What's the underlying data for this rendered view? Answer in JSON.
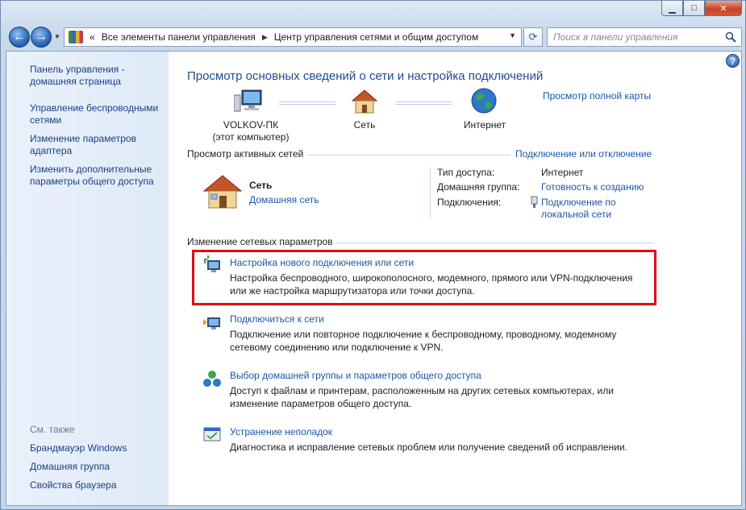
{
  "window": {
    "caption_buttons": {
      "minimize": "▁",
      "maximize": "□",
      "close": "✕"
    }
  },
  "navbar": {
    "back_icon": "back-arrow-icon",
    "forward_icon": "forward-arrow-icon",
    "address": {
      "overflow": "«",
      "segments": [
        "Все элементы панели управления",
        "Центр управления сетями и общим доступом"
      ]
    },
    "search_placeholder": "Поиск в панели управления"
  },
  "sidebar": {
    "items": [
      {
        "label_line1": "Панель управления -",
        "label_line2": "домашняя страница"
      },
      {
        "label_line1": "Управление беспроводными",
        "label_line2": "сетями"
      },
      {
        "label_line1": "Изменение параметров",
        "label_line2": "адаптера"
      },
      {
        "label_line1": "Изменить дополнительные",
        "label_line2": "параметры общего доступа"
      }
    ],
    "see_also_label": "См. также",
    "see_also": [
      "Брандмауэр Windows",
      "Домашняя группа",
      "Свойства браузера"
    ]
  },
  "main": {
    "title": "Просмотр основных сведений о сети и настройка подключений",
    "full_map_link": "Просмотр полной карты",
    "map": {
      "computer_name": "VOLKOV-ПК",
      "computer_sub": "(этот компьютер)",
      "network": "Сеть",
      "internet": "Интернет"
    },
    "active_networks": {
      "section_label": "Просмотр активных сетей",
      "connect_link": "Подключение или отключение",
      "network_name": "Сеть",
      "network_type_link": "Домашняя сеть",
      "access_type_label": "Тип доступа:",
      "access_type_value": "Интернет",
      "homegroup_label": "Домашняя группа:",
      "homegroup_value": "Готовность к созданию",
      "connections_label": "Подключения:",
      "connections_value_line1": "Подключение по",
      "connections_value_line2": "локальной сети"
    },
    "change_settings": {
      "section_label": "Изменение сетевых параметров",
      "tasks": [
        {
          "title": "Настройка нового подключения или сети",
          "desc_line1": "Настройка беспроводного, широкополосного, модемного, прямого или VPN-подключения",
          "desc_line2": "или же настройка маршрутизатора или точки доступа."
        },
        {
          "title": "Подключиться к сети",
          "desc_line1": "Подключение или повторное подключение к беспроводному, проводному, модемному",
          "desc_line2": "сетевому соединению или подключение к VPN."
        },
        {
          "title": "Выбор домашней группы и параметров общего доступа",
          "desc_line1": "Доступ к файлам и принтерам, расположенным на других сетевых компьютерах, или",
          "desc_line2": "изменение параметров общего доступа."
        },
        {
          "title": "Устранение неполадок",
          "desc_line1": "Диагностика и исправление сетевых проблем или получение сведений об исправлении.",
          "desc_line2": ""
        }
      ]
    }
  },
  "colors": {
    "link": "#1a56a8",
    "title": "#1e4b8f",
    "highlight": "#e00a14",
    "sidebar_bg": "#e4eefa"
  }
}
